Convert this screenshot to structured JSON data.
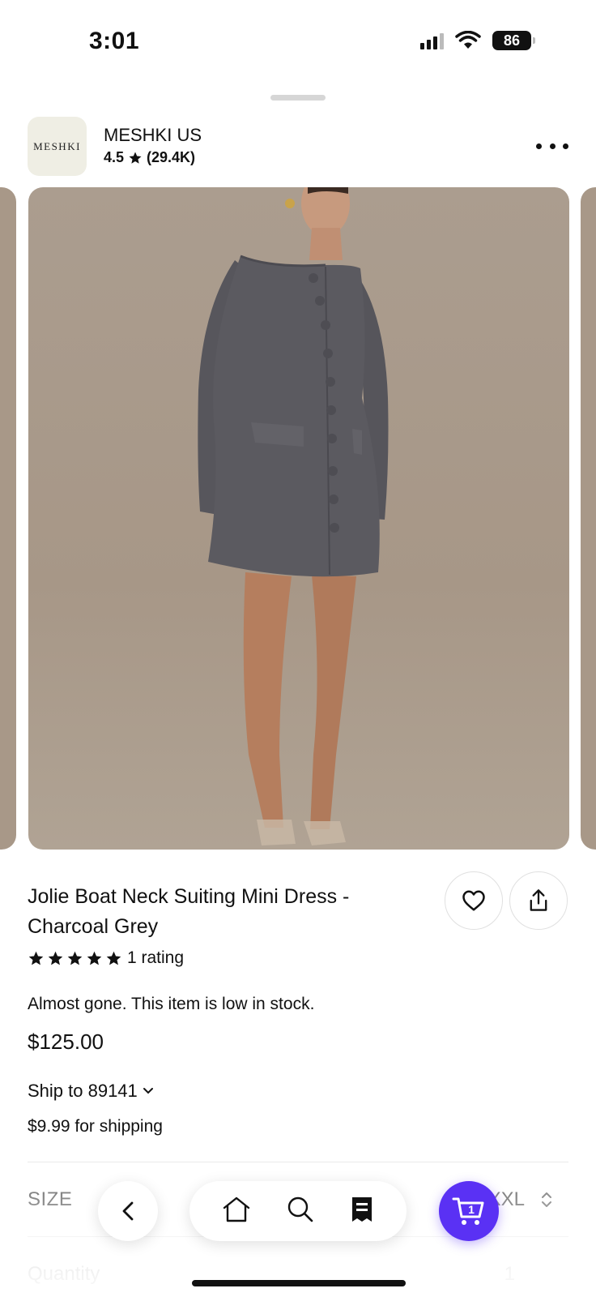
{
  "status_bar": {
    "time": "3:01",
    "battery": "86"
  },
  "store": {
    "logo_text": "MESHKI",
    "name": "MESHKI US",
    "rating": "4.5",
    "reviews": "(29.4K)"
  },
  "product": {
    "title": "Jolie Boat Neck Suiting Mini Dress - Charcoal Grey",
    "rating_text": "1 rating",
    "stars": 5,
    "stock_message": "Almost gone. This item is low in stock.",
    "price": "$125.00",
    "ship_to": "Ship to 89141",
    "shipping_cost": "$9.99 for shipping"
  },
  "options": {
    "size_label": "SIZE",
    "size_value": "XXL",
    "quantity_label": "Quantity",
    "quantity_value": "1"
  },
  "nav": {
    "cart_count": "1"
  },
  "colors": {
    "accent": "#5a31f4",
    "image_bg": "#a89888",
    "dress": "#5b5a60"
  }
}
